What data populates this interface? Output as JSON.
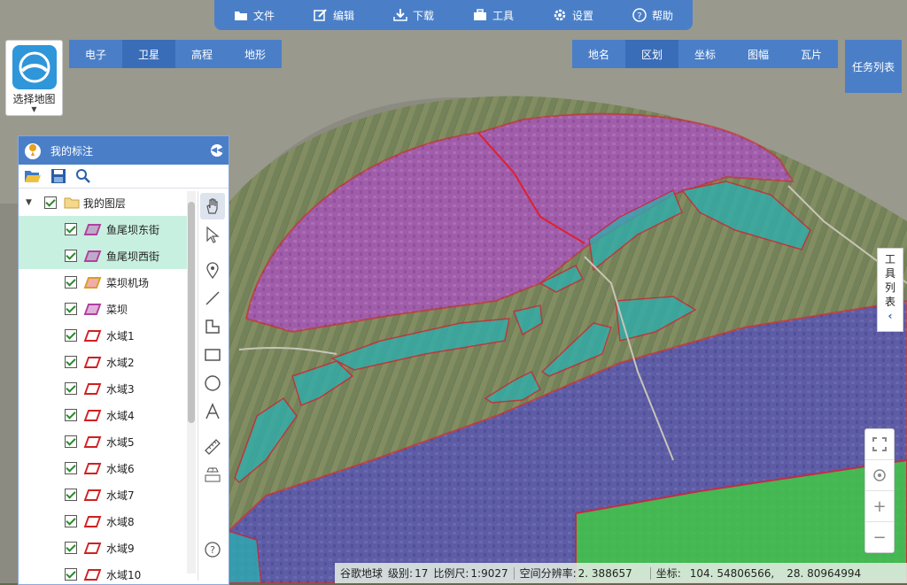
{
  "toolbar": {
    "file": "文件",
    "edit": "编辑",
    "download": "下载",
    "tools": "工具",
    "settings": "设置",
    "help": "帮助"
  },
  "map_selector": {
    "label": "选择地图"
  },
  "map_types": [
    "电子",
    "卫星",
    "高程",
    "地形"
  ],
  "overlays": [
    "地名",
    "区划",
    "坐标",
    "图幅",
    "瓦片"
  ],
  "task_list": "任务列表",
  "panel": {
    "title": "我的标注",
    "root": "我的图层",
    "items": [
      {
        "label": "鱼尾坝东街",
        "color": "#b040a0"
      },
      {
        "label": "鱼尾坝西街",
        "color": "#b040a0"
      },
      {
        "label": "菜坝机场",
        "color": "#d8a020"
      },
      {
        "label": "菜坝",
        "color": "#b040a0"
      },
      {
        "label": "水域1",
        "color": "#d02020"
      },
      {
        "label": "水域2",
        "color": "#d02020"
      },
      {
        "label": "水域3",
        "color": "#d02020"
      },
      {
        "label": "水域4",
        "color": "#d02020"
      },
      {
        "label": "水域5",
        "color": "#d02020"
      },
      {
        "label": "水域6",
        "color": "#d02020"
      },
      {
        "label": "水域7",
        "color": "#d02020"
      },
      {
        "label": "水域8",
        "color": "#d02020"
      },
      {
        "label": "水域9",
        "color": "#d02020"
      },
      {
        "label": "水域10",
        "color": "#d02020"
      }
    ]
  },
  "side_tab": [
    "工",
    "具",
    "列",
    "表",
    "‹"
  ],
  "zoom": {
    "plus": "+",
    "minus": "−"
  },
  "status": {
    "source": "谷歌地球",
    "level_label": "级别:",
    "level": "17",
    "scale_label": "比例尺:",
    "scale": "1:9027",
    "resolution_label": "空间分辨率:",
    "resolution": "2. 388657",
    "coord_label": "坐标:",
    "lon": "104. 54806566,",
    "lat": "28. 80964994"
  }
}
